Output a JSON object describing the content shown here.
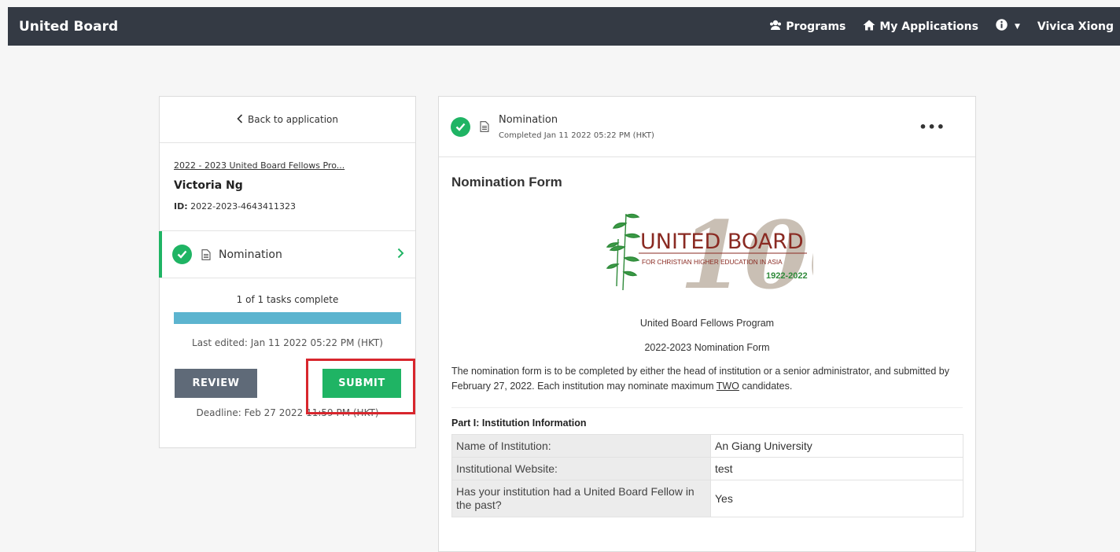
{
  "topbar": {
    "brand": "United Board",
    "nav": [
      {
        "label": "Programs",
        "icon": "programs-icon"
      },
      {
        "label": "My Applications",
        "icon": "home-icon"
      }
    ],
    "info_icon": "info-icon",
    "user_name": "Vivica Xiong"
  },
  "sidebar": {
    "back_label": "Back to application",
    "program_link": "2022 - 2023 United Board Fellows Pro...",
    "applicant_name": "Victoria Ng",
    "id_label": "ID:",
    "id_value": "2022-2023-4643411323",
    "task": {
      "label": "Nomination",
      "status": "complete"
    },
    "progress_text": "1 of 1 tasks complete",
    "progress_fraction": 1.0,
    "last_edited": "Last edited: Jan 11 2022 05:22 PM (HKT)",
    "review_label": "REVIEW",
    "submit_label": "SUBMIT",
    "deadline": "Deadline: Feb 27 2022 11:59 PM (HKT)"
  },
  "task_panel": {
    "title": "Nomination",
    "subtitle": "Completed Jan 11 2022 05:22 PM (HKT)",
    "more_label": "•••"
  },
  "form": {
    "title": "Nomination Form",
    "logo": {
      "main": "UNITED BOARD",
      "sub": "FOR CHRISTIAN HIGHER EDUCATION IN ASIA",
      "years": "1922-2022",
      "watermark": "100"
    },
    "program": "United Board Fellows Program",
    "form_name": "2022-2023 Nomination Form",
    "desc_before": "The nomination form is to be completed by either the head of institution or a senior administrator, and submitted by February 27, 2022. Each institution may nominate maximum ",
    "desc_emph": "TWO",
    "desc_after": " candidates.",
    "part1_title": "Part I: Institution Information",
    "rows": [
      {
        "label": "Name of Institution:",
        "value": "An Giang University"
      },
      {
        "label": "Institutional Website:",
        "value": "test"
      },
      {
        "label": "Has your institution had a United Board Fellow in the past?",
        "value": "Yes"
      }
    ]
  },
  "colors": {
    "topbar": "#343a44",
    "accent_green": "#1fb464",
    "progress": "#5cb4cf",
    "review_button": "#5f6a78",
    "highlight": "#d8262d"
  }
}
